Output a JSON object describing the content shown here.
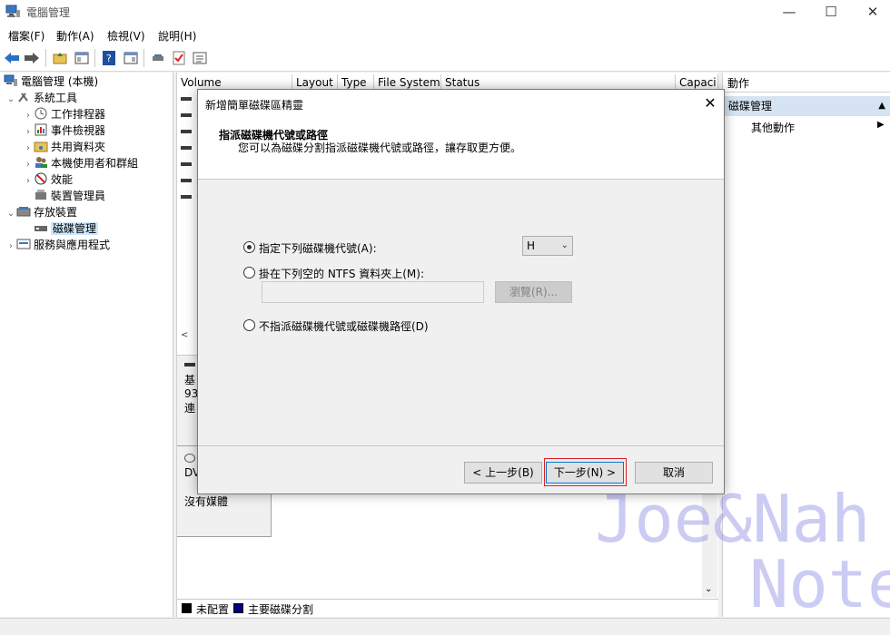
{
  "window": {
    "title": "電腦管理",
    "min": "—",
    "max": "☐",
    "close": "✕"
  },
  "menu": {
    "file": "檔案(F)",
    "action": "動作(A)",
    "view": "檢視(V)",
    "help": "說明(H)"
  },
  "tree": {
    "root": "電腦管理 (本機)",
    "system_tools": "系統工具",
    "task_scheduler": "工作排程器",
    "event_viewer": "事件檢視器",
    "shared_folders": "共用資料夾",
    "local_users": "本機使用者和群組",
    "performance": "效能",
    "device_manager": "裝置管理員",
    "storage": "存放裝置",
    "disk_management": "磁碟管理",
    "services_apps": "服務與應用程式"
  },
  "volume_table": {
    "columns": [
      "Volume",
      "Layout",
      "Type",
      "File System",
      "Status",
      "Capaci"
    ]
  },
  "disk_area": {
    "disk1_lines": [
      "基",
      "93",
      "連"
    ],
    "disk2_label": "DV",
    "no_media": "沒有媒體"
  },
  "legend": {
    "unallocated": "未配置",
    "primary": "主要磁碟分割",
    "unallocated_color": "#000000",
    "primary_color": "#000080"
  },
  "actions": {
    "header": "動作",
    "section": "磁碟管理",
    "more": "其他動作"
  },
  "dialog": {
    "title": "新增簡單磁碟區精靈",
    "heading": "指派磁碟機代號或路徑",
    "subtitle": "您可以為磁碟分割指派磁碟機代號或路徑，讓存取更方便。",
    "option_assign": "指定下列磁碟機代號(A):",
    "drive_letter": "H",
    "option_mount": "掛在下列空的 NTFS 資料夾上(M):",
    "browse": "瀏覽(R)...",
    "option_none": "不指派磁碟機代號或磁碟機路徑(D)",
    "back": "< 上一步(B)",
    "next": "下一步(N) >",
    "cancel": "取消",
    "close": "✕"
  },
  "watermark": {
    "line1": "Joe&Nah",
    "line2": "Notes"
  }
}
